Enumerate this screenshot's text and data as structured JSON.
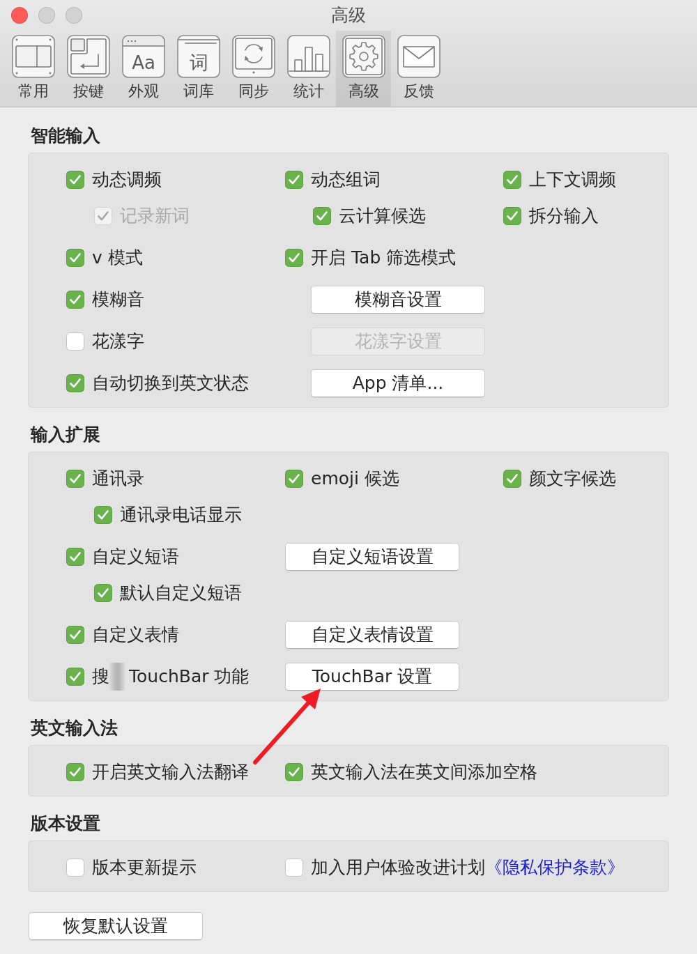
{
  "window": {
    "title": "高级",
    "buttons": [
      {
        "kind": "close",
        "disabled": false
      },
      {
        "kind": "minimize",
        "disabled": true
      },
      {
        "kind": "zoom",
        "disabled": true
      }
    ]
  },
  "toolbar": [
    {
      "label": "常用",
      "kind": "panels",
      "selected": false
    },
    {
      "label": "按键",
      "kind": "keys",
      "selected": false
    },
    {
      "label": "外观",
      "kind": "appearance",
      "glyph": "Aa",
      "selected": false
    },
    {
      "label": "词库",
      "kind": "dictionary",
      "glyph": "词",
      "selected": false
    },
    {
      "label": "同步",
      "kind": "sync",
      "selected": false
    },
    {
      "label": "统计",
      "kind": "stats",
      "selected": false
    },
    {
      "label": "高级",
      "kind": "gear",
      "selected": true
    },
    {
      "label": "反馈",
      "kind": "mail",
      "selected": false
    }
  ],
  "sections": [
    {
      "title": "智能输入",
      "rows": [
        [
          [
            {
              "kind": "checkbox",
              "label": "动态调频",
              "checked": true,
              "disabled": false,
              "children": [
                {
                  "kind": "checkbox",
                  "label": "记录新词",
                  "checked": true,
                  "disabled": true
                }
              ]
            }
          ],
          [
            {
              "kind": "checkbox",
              "label": "动态组词",
              "checked": true,
              "disabled": false,
              "children": [
                {
                  "kind": "checkbox",
                  "label": "云计算候选",
                  "checked": true,
                  "disabled": false
                }
              ]
            }
          ],
          [
            {
              "kind": "checkbox",
              "label": "上下文调频",
              "checked": true,
              "disabled": false
            },
            {
              "kind": "checkbox",
              "label": "拆分输入",
              "checked": true,
              "disabled": false
            }
          ]
        ],
        [
          [
            {
              "kind": "checkbox",
              "label": "v 模式",
              "checked": true,
              "disabled": false
            }
          ],
          [
            {
              "kind": "checkbox",
              "label": "开启 Tab 筛选模式",
              "checked": true,
              "disabled": false
            }
          ]
        ],
        [
          [
            {
              "kind": "checkbox",
              "label": "模糊音",
              "checked": true,
              "disabled": false
            }
          ],
          [
            {
              "kind": "button",
              "label": "模糊音设置",
              "disabled": false
            }
          ]
        ],
        [
          [
            {
              "kind": "checkbox",
              "label": "花漾字",
              "checked": false,
              "disabled": false
            }
          ],
          [
            {
              "kind": "button",
              "label": "花漾字设置",
              "disabled": true
            }
          ]
        ],
        [
          [
            {
              "kind": "checkbox",
              "label": "自动切换到英文状态",
              "checked": true,
              "disabled": false
            }
          ],
          [
            {
              "kind": "button",
              "label": "App 清单...",
              "disabled": false
            }
          ]
        ]
      ]
    },
    {
      "title": "输入扩展",
      "rows": [
        [
          [
            {
              "kind": "checkbox",
              "label": "通讯录",
              "checked": true,
              "disabled": false,
              "children": [
                {
                  "kind": "checkbox",
                  "label": "通讯录电话显示",
                  "checked": true,
                  "disabled": false
                }
              ]
            }
          ],
          [
            {
              "kind": "checkbox",
              "label": "emoji 候选",
              "checked": true,
              "disabled": false
            }
          ],
          [
            {
              "kind": "checkbox",
              "label": "颜文字候选",
              "checked": true,
              "disabled": false
            }
          ]
        ],
        [
          [
            {
              "kind": "checkbox",
              "label": "自定义短语",
              "checked": true,
              "disabled": false,
              "children": [
                {
                  "kind": "checkbox",
                  "label": "默认自定义短语",
                  "checked": true,
                  "disabled": false
                }
              ]
            }
          ],
          [
            {
              "kind": "button",
              "label": "自定义短语设置",
              "disabled": false
            }
          ]
        ],
        [
          [
            {
              "kind": "checkbox",
              "label": "自定义表情",
              "checked": true,
              "disabled": false
            }
          ],
          [
            {
              "kind": "button",
              "label": "自定义表情设置",
              "disabled": false
            }
          ]
        ],
        [
          [
            {
              "kind": "checkbox",
              "label": "搜",
              "redacted": true,
              "label_after": "TouchBar 功能",
              "checked": true,
              "disabled": false
            }
          ],
          [
            {
              "kind": "button",
              "label": "TouchBar 设置",
              "disabled": false
            }
          ]
        ]
      ]
    },
    {
      "title": "英文输入法",
      "rows": [
        [
          [
            {
              "kind": "checkbox",
              "label": "开启英文输入法翻译",
              "checked": true,
              "disabled": false
            }
          ],
          [
            {
              "kind": "checkbox",
              "label": "英文输入法在英文间添加空格",
              "checked": true,
              "disabled": false
            }
          ]
        ]
      ]
    },
    {
      "title": "版本设置",
      "rows": [
        [
          [
            {
              "kind": "checkbox",
              "label": "版本更新提示",
              "checked": false,
              "disabled": false
            }
          ],
          [
            {
              "kind": "checkbox",
              "label": "加入用户体验改进计划",
              "link": "《隐私保护条款》",
              "checked": false,
              "disabled": false
            }
          ]
        ]
      ]
    }
  ],
  "reset_button": {
    "label": "恢复默认设置",
    "disabled": false
  },
  "annotation": {
    "kind": "arrow"
  }
}
